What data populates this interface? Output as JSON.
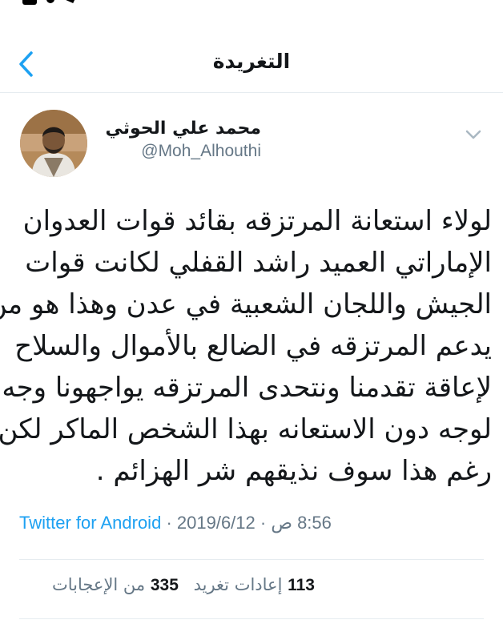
{
  "nav": {
    "title": "التغريدة",
    "back_icon": "chevron-left-icon"
  },
  "tweet": {
    "display_name": "محمد علي الحوثي",
    "username": "@Moh_Alhouthi",
    "lines": [
      "لولاء استعانة المرتزقه بقائد قوات العدوان",
      "الإماراتي العميد راشد القفلي لكانت قوات",
      "الجيش واللجان الشعبية في عدن وهذا هو من",
      "يدعم المرتزقه في الضالع بالأموال والسلاح",
      "لإعاقة تقدمنا ونتحدى المرتزقه يواجهونا وجه",
      "لوجه دون الاستعانه بهذا الشخص الماكر لكن",
      "رغم هذا سوف نذيقهم شر الهزائم ."
    ],
    "source": "Twitter for Android",
    "date": "2019/6/12",
    "time": "8:56 ص",
    "separator": "·"
  },
  "stats": {
    "retweets_count": "113",
    "retweets_label": "إعادات تغريد",
    "likes_count": "335",
    "likes_label": "من الإعجابات"
  },
  "colors": {
    "accent": "#1da1f2",
    "text": "#14171a",
    "muted": "#657786",
    "divider": "#e6ecf0"
  }
}
